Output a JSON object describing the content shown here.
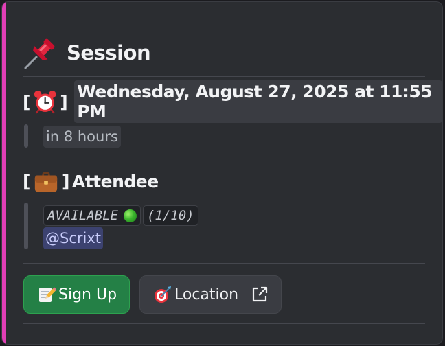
{
  "embed": {
    "accent_color": "#e13fb6",
    "title": "Session",
    "title_icon": "pushpin-icon"
  },
  "time_field": {
    "open_bracket": "[",
    "close_bracket": "]",
    "icon": "alarm-clock-icon",
    "timestamp": "Wednesday, August 27, 2025 at 11:55 PM",
    "relative": "in 8 hours"
  },
  "attendee_field": {
    "open_bracket": "[",
    "close_bracket": "]",
    "icon": "briefcase-icon",
    "label": "Attendee",
    "status": "AVAILABLE",
    "status_icon": "green-circle-icon",
    "count": "(1/10)",
    "mention": "@Scrixt"
  },
  "buttons": {
    "signup": {
      "label": "Sign Up",
      "icon": "memo-pencil-icon",
      "color": "#248046"
    },
    "location": {
      "label": "Location",
      "icon": "target-icon",
      "trailing_icon": "external-link-icon"
    }
  }
}
